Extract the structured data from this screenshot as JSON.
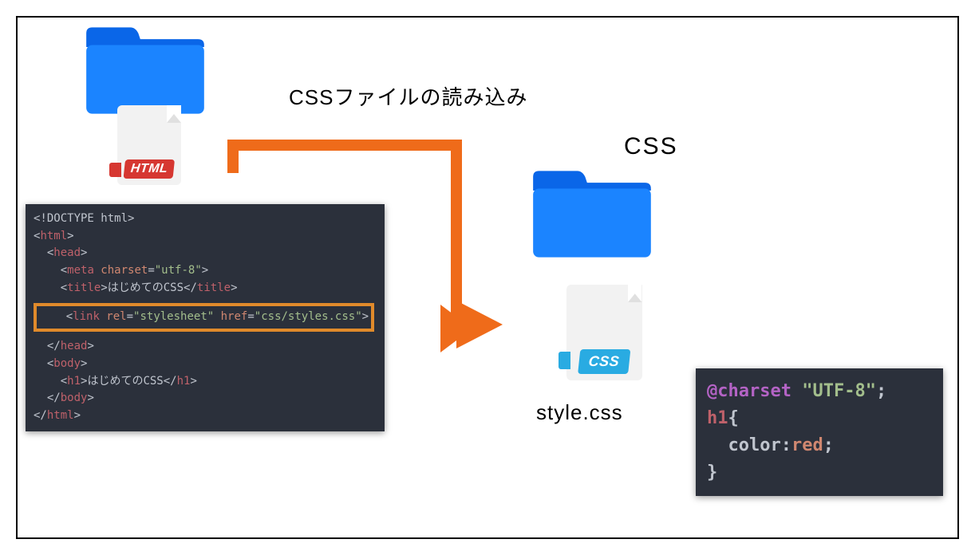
{
  "title": "CSSファイルの読み込み",
  "cssFolderLabel": "CSS",
  "cssFileLabel": "style.css",
  "badges": {
    "html": "HTML",
    "css": "CSS"
  },
  "htmlCode": {
    "l1": "<!DOCTYPE html>",
    "l2_open": "<",
    "l2_tag": "html",
    "l2_close": ">",
    "l3": "  <",
    "l3_tag": "head",
    "l3_close": ">",
    "l4": "    <",
    "l4_tag": "meta",
    "l4_attr": " charset",
    "l4_eq": "=",
    "l4_str": "\"utf-8\"",
    "l4_close": ">",
    "l5": "    <",
    "l5_tag": "title",
    "l5_close": ">",
    "l5_txt": "はじめてのCSS",
    "l5_end": "</",
    "l5_endc": ">",
    "l6": "    <",
    "l6_tag": "link",
    "l6_attr1": " rel",
    "l6_eq1": "=",
    "l6_str1": "\"stylesheet\"",
    "l6_attr2": " href",
    "l6_eq2": "=",
    "l6_str2": "\"css/styles.css\"",
    "l6_close": ">",
    "l7": "  </",
    "l7_tag": "head",
    "l7_close": ">",
    "l8": "  <",
    "l8_tag": "body",
    "l8_close": ">",
    "l9": "    <",
    "l9_tag": "h1",
    "l9_close": ">",
    "l9_txt": "はじめてのCSS",
    "l9_end": "</",
    "l9_endc": ">",
    "l10": "  </",
    "l10_tag": "body",
    "l10_close": ">",
    "l11": "</",
    "l11_tag": "html",
    "l11_close": ">"
  },
  "cssCode": {
    "l1_at": "@charset",
    "l1_sp": " ",
    "l1_str": "\"UTF-8\"",
    "l1_semi": ";",
    "l2_sel": "h1",
    "l2_brace": "{",
    "l3_pad": "  ",
    "l3_prop": "color",
    "l3_colon": ":",
    "l3_val": "red",
    "l3_semi": ";",
    "l4_brace": "}"
  }
}
